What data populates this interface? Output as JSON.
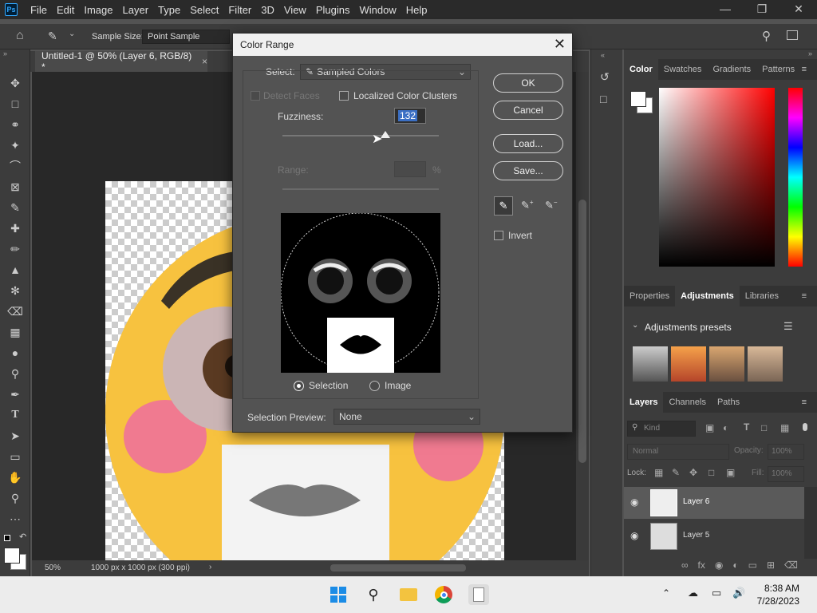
{
  "app": {
    "logo": "Ps",
    "menu": [
      "File",
      "Edit",
      "Image",
      "Layer",
      "Type",
      "Select",
      "Filter",
      "3D",
      "View",
      "Plugins",
      "Window",
      "Help"
    ],
    "window_controls": [
      "minimize-icon",
      "restore-icon",
      "close-icon"
    ]
  },
  "options_bar": {
    "sample_size_label": "Sample Size:",
    "sample_size_value": "Point Sample"
  },
  "document": {
    "tab_title": "Untitled-1 @ 50% (Layer 6, RGB/8) *",
    "zoom": "50%",
    "dimensions": "1000 px x 1000 px (300 ppi)"
  },
  "dialog": {
    "title": "Color Range",
    "select_label": "Select:",
    "select_value": "Sampled Colors",
    "detect_faces_label": "Detect Faces",
    "localized_label": "Localized Color Clusters",
    "fuzziness_label": "Fuzziness:",
    "fuzziness_value": "132",
    "fuzziness_fraction": 0.66,
    "range_label": "Range:",
    "range_unit": "%",
    "selection_label": "Selection",
    "image_label": "Image",
    "preview_label": "Selection Preview:",
    "preview_value": "None",
    "invert_label": "Invert",
    "buttons": {
      "ok": "OK",
      "cancel": "Cancel",
      "load": "Load...",
      "save": "Save..."
    }
  },
  "panels": {
    "color_tabs": [
      "Color",
      "Swatches",
      "Gradients",
      "Patterns"
    ],
    "properties_tabs": [
      "Properties",
      "Adjustments",
      "Libraries"
    ],
    "adjustments_presets": "Adjustments presets",
    "layers_tabs": [
      "Layers",
      "Channels",
      "Paths"
    ],
    "kind_placeholder": "Kind",
    "blend_mode": "Normal",
    "opacity_label": "Opacity:",
    "opacity_value": "100%",
    "lock_label": "Lock:",
    "fill_label": "Fill:",
    "fill_value": "100%",
    "layers": [
      "Layer 6",
      "Layer 5"
    ]
  },
  "taskbar": {
    "time": "8:38 AM",
    "date": "7/28/2023"
  },
  "colors": {
    "accent": "#31a8ff",
    "emoji_yellow": "#f7c23f",
    "blush": "#f06a8a"
  }
}
